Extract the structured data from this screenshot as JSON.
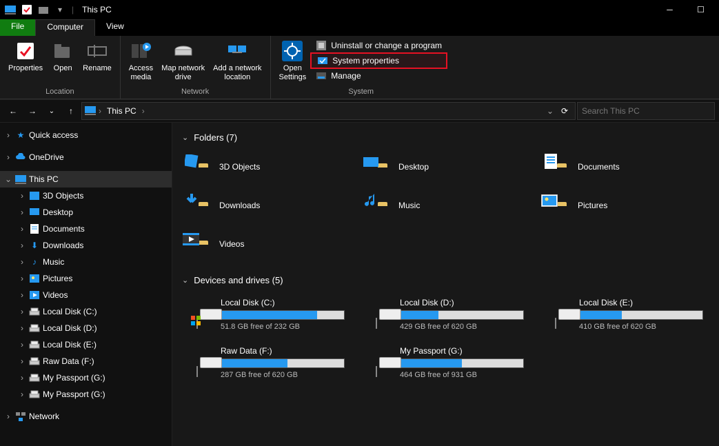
{
  "window": {
    "title": "This PC"
  },
  "ribbon": {
    "tabs": {
      "file": "File",
      "computer": "Computer",
      "view": "View"
    },
    "location": {
      "properties": "Properties",
      "open": "Open",
      "rename": "Rename",
      "group": "Location"
    },
    "network": {
      "access_media": "Access\nmedia",
      "map_drive": "Map network\ndrive",
      "add_location": "Add a network\nlocation",
      "group": "Network"
    },
    "system": {
      "open_settings": "Open\nSettings",
      "uninstall": "Uninstall or change a program",
      "system_properties": "System properties",
      "manage": "Manage",
      "group": "System"
    }
  },
  "address": {
    "location": "This PC"
  },
  "search": {
    "placeholder": "Search This PC"
  },
  "sidebar": {
    "quick_access": "Quick access",
    "onedrive": "OneDrive",
    "this_pc": "This PC",
    "items": [
      "3D Objects",
      "Desktop",
      "Documents",
      "Downloads",
      "Music",
      "Pictures",
      "Videos",
      "Local Disk (C:)",
      "Local Disk (D:)",
      "Local Disk (E:)",
      "Raw Data (F:)",
      "My Passport (G:)",
      "My Passport (G:)"
    ],
    "network": "Network"
  },
  "content": {
    "folders_header": "Folders (7)",
    "folders": [
      "3D Objects",
      "Desktop",
      "Documents",
      "Downloads",
      "Music",
      "Pictures",
      "Videos"
    ],
    "drives_header": "Devices and drives (5)",
    "drives": [
      {
        "name": "Local Disk (C:)",
        "free": "51.8 GB free of 232 GB",
        "pct": 78
      },
      {
        "name": "Local Disk (D:)",
        "free": "429 GB free of 620 GB",
        "pct": 31
      },
      {
        "name": "Local Disk (E:)",
        "free": "410 GB free of 620 GB",
        "pct": 34
      },
      {
        "name": "Raw Data (F:)",
        "free": "287 GB free of 620 GB",
        "pct": 54
      },
      {
        "name": "My Passport (G:)",
        "free": "464 GB free of 931 GB",
        "pct": 50
      }
    ]
  }
}
